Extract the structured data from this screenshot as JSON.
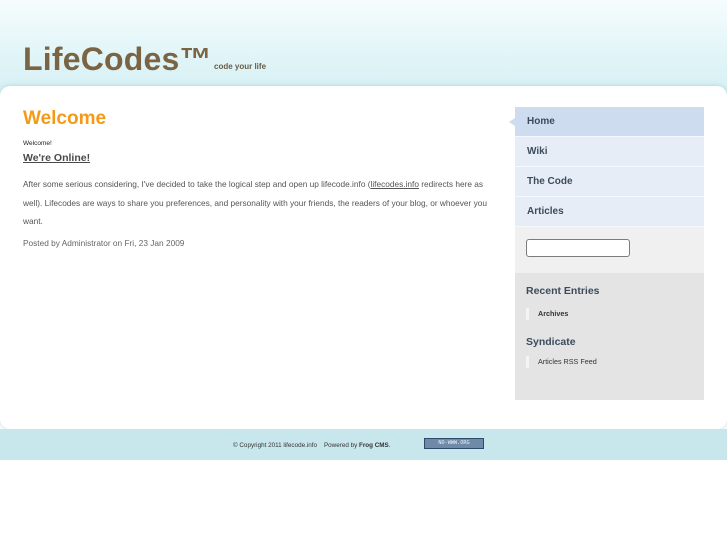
{
  "header": {
    "site_title": "LifeCodes™",
    "tagline": "code your life"
  },
  "main": {
    "page_title": "Welcome",
    "welcome_small": "Welcome!",
    "post_title": "We're Online!",
    "body_before_link": "After some serious considering, I've decided to take the logical step and open up lifecode.info (",
    "body_link": "lifecodes.info",
    "body_after_link": " redirects here as well). Lifecodes are ways to share you preferences, and personality with your friends, the readers of your blog, or whoever you want.",
    "posted_by": "Posted by Administrator on Fri, 23 Jan 2009"
  },
  "sidebar": {
    "nav": [
      {
        "label": "Home",
        "active": true
      },
      {
        "label": "Wiki",
        "active": false
      },
      {
        "label": "The Code",
        "active": false
      },
      {
        "label": "Articles",
        "active": false
      }
    ],
    "search_value": "",
    "recent_heading": "Recent Entries",
    "recent_items": [
      "Archives"
    ],
    "syndicate_heading": "Syndicate",
    "syndicate_items": [
      "Articles RSS Feed"
    ]
  },
  "footer": {
    "copyright": "© Copyright 2011 lifecode.info",
    "powered_by": "Powered by",
    "cms_name": "Frog CMS",
    "badge_text": "NO-WWW.ORG"
  }
}
